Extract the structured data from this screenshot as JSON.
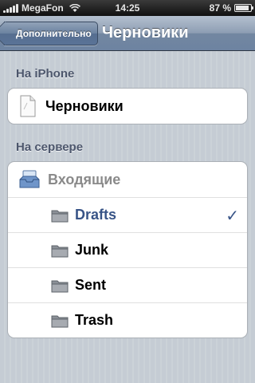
{
  "status_bar": {
    "carrier": "MegaFon",
    "time": "14:25",
    "battery_text": "87 %",
    "battery_level": 0.87
  },
  "nav_bar": {
    "back_label": "Дополнительно",
    "title": "Черновики"
  },
  "sections": {
    "iphone": {
      "header": "На iPhone",
      "items": [
        {
          "label": "Черновики",
          "icon": "document-icon"
        }
      ]
    },
    "server": {
      "header": "На сервере",
      "account": {
        "label": "Входящие",
        "icon": "inbox-tray-icon"
      },
      "folders": [
        {
          "label": "Drafts",
          "selected": true,
          "icon": "folder-icon"
        },
        {
          "label": "Junk",
          "selected": false,
          "icon": "folder-icon"
        },
        {
          "label": "Sent",
          "selected": false,
          "icon": "folder-icon"
        },
        {
          "label": "Trash",
          "selected": false,
          "icon": "folder-icon"
        }
      ],
      "checkmark": "✓"
    }
  },
  "colors": {
    "background": "#c5ccd4",
    "selected_text": "#385487",
    "section_header": "#4c566c"
  }
}
